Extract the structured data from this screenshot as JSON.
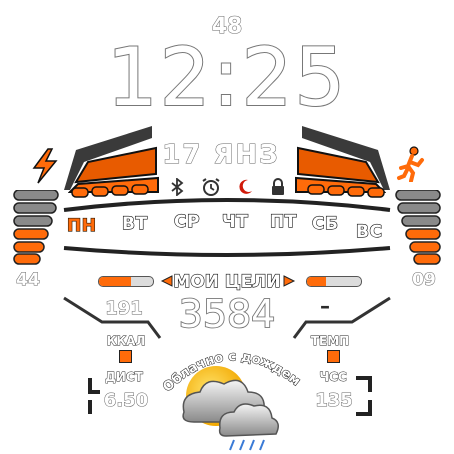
{
  "top": {
    "seconds": "48",
    "time": "12:25",
    "date": "17 ЯНЗ"
  },
  "status_icons": [
    "bluetooth-icon",
    "alarm-clock-icon",
    "moon-icon",
    "lock-icon"
  ],
  "week": {
    "days": [
      "ПН",
      "ВТ",
      "СР",
      "ЧТ",
      "ПТ",
      "СБ",
      "ВС"
    ],
    "active_index": 0
  },
  "left_gauge": {
    "icon": "lightning-icon",
    "value": "44",
    "level": 0.6
  },
  "right_gauge": {
    "icon": "walking-person-icon",
    "value": "09",
    "level": 0.6
  },
  "goals": {
    "label": "МОИ ЦЕЛИ",
    "steps": "3584",
    "left_progress": 0.6,
    "right_progress": 0.35
  },
  "stats": {
    "kcal_value": "191",
    "kcal_label": "ККАЛ",
    "tempo_value": "–",
    "tempo_label": "ТЕМП",
    "distance_label": "ДИСТ",
    "distance_value": "6.50",
    "heart_label": "ЧСС",
    "heart_value": "135"
  },
  "weather": {
    "text": "Облачно с дождем",
    "icon": "cloudy-rain-icon"
  },
  "colors": {
    "accent": "#ff6b0a",
    "accent_dark": "#e85b00",
    "gray": "#8a8a8a",
    "outline": "#6a6a6a"
  }
}
